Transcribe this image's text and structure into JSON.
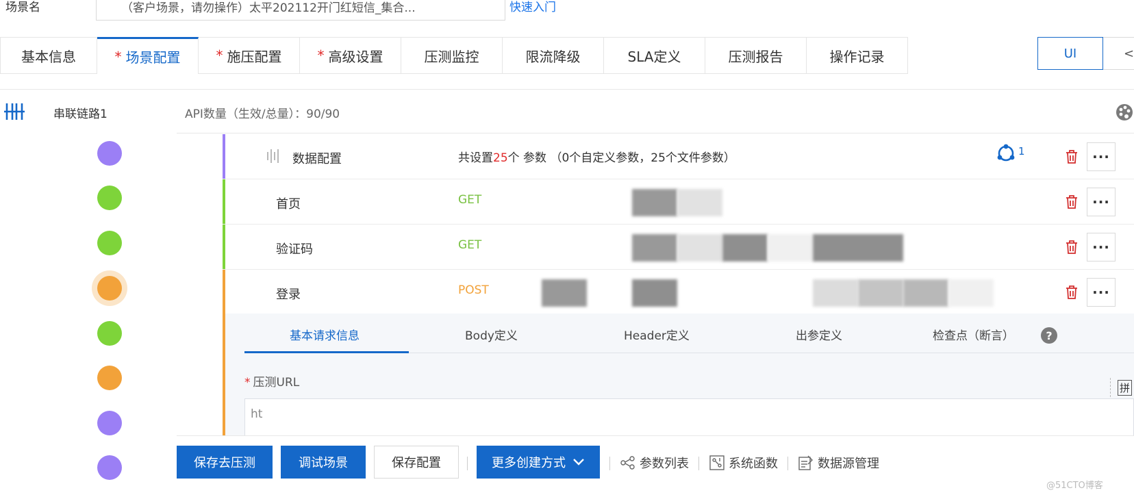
{
  "scene": {
    "label": "场景名",
    "name_value": "（客户场景，请勿操作）太平202112开门红短信_集合...",
    "quick_link": "快速入门"
  },
  "tabs": [
    {
      "label": "基本信息",
      "required": false
    },
    {
      "label": "场景配置",
      "required": true
    },
    {
      "label": "施压配置",
      "required": true
    },
    {
      "label": "高级设置",
      "required": true
    },
    {
      "label": "压测监控",
      "required": false
    },
    {
      "label": "限流降级",
      "required": false
    },
    {
      "label": "SLA定义",
      "required": false
    },
    {
      "label": "压测报告",
      "required": false
    },
    {
      "label": "操作记录",
      "required": false
    }
  ],
  "active_tab": "场景配置",
  "view_toggle": {
    "ui": "UI",
    "code": "</"
  },
  "chain": {
    "name": "串联链路1",
    "api_count": "API数量（生效/总量）：90/90"
  },
  "data_config": {
    "name": "数据配置",
    "summary_prefix": "共设置",
    "summary_num": "25",
    "summary_suffix": "个 参数 （0个自定义参数，25个文件参数）",
    "share_count": "1"
  },
  "apis": [
    {
      "name": "首页",
      "method": "GET",
      "method_color": "#7ac143"
    },
    {
      "name": "验证码",
      "method": "GET",
      "method_color": "#7ac143"
    },
    {
      "name": "登录",
      "method": "POST",
      "method_color": "#f2a23a"
    }
  ],
  "more_label": "···",
  "detail": {
    "subtabs": [
      "基本请求信息",
      "Body定义",
      "Header定义",
      "出参定义",
      "检查点（断言）"
    ],
    "help": "?",
    "url_label": "压测URL",
    "url_value": "ht",
    "pin_label": "拼"
  },
  "toolbar": {
    "save_test": "保存去压测",
    "debug": "调试场景",
    "save_config": "保存配置",
    "more_create": "更多创建方式",
    "param_list": "参数列表",
    "sys_func": "系统函数",
    "datasource": "数据源管理"
  },
  "watermark": "@51CTO博客",
  "colors": {
    "primary": "#1568c9",
    "required": "#e02b2b",
    "purple": "#9b7ff5",
    "green": "#7ed43a",
    "orange": "#f2a23a"
  }
}
